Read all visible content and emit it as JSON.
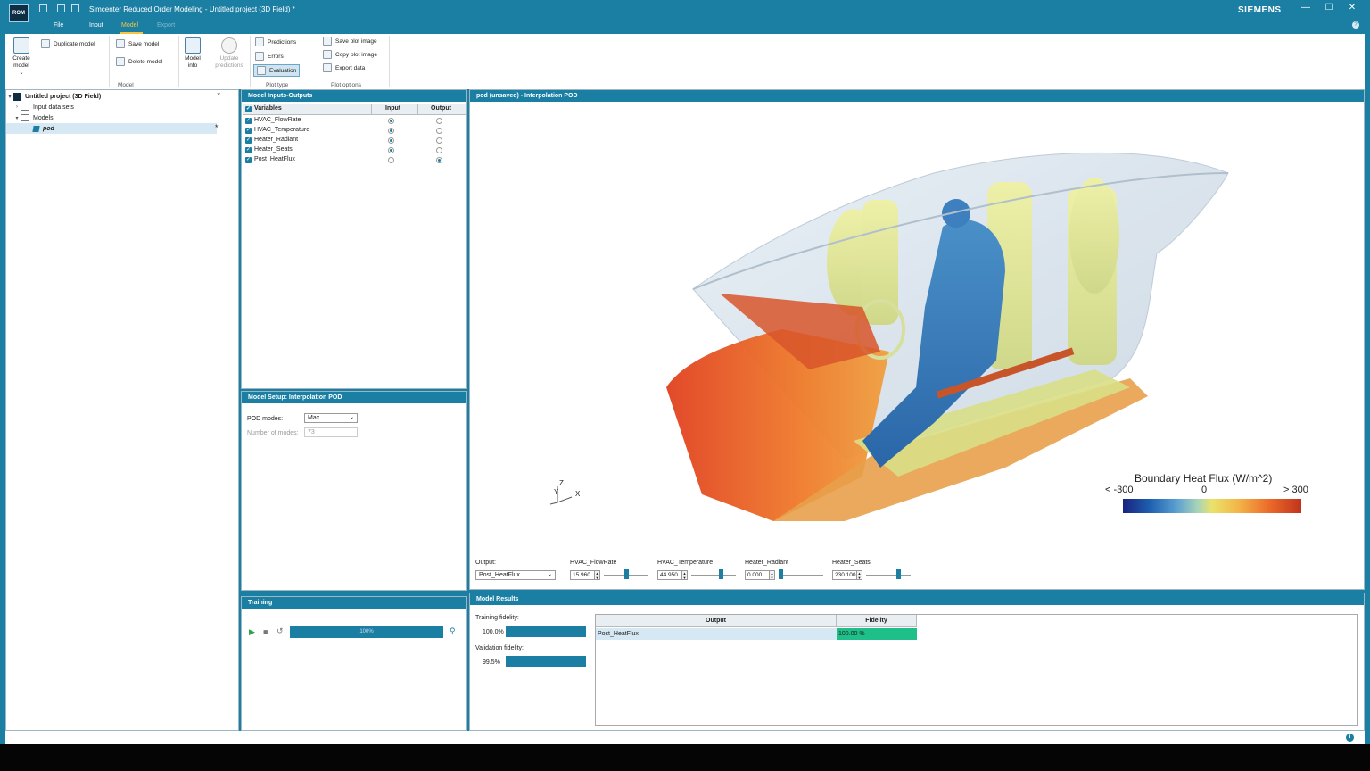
{
  "app": {
    "title": "Simcenter Reduced Order Modeling - Untitled project (3D Field) *",
    "brand": "SIEMENS",
    "logo_text": "ROM",
    "window_controls": [
      "—",
      "☐",
      "✕"
    ],
    "help": "?"
  },
  "menu": {
    "file": "File",
    "input": "Input",
    "model": "Model",
    "export": "Export",
    "active": "Model"
  },
  "ribbon": {
    "create_model": "Create model",
    "duplicate_model": "Duplicate model",
    "save_model": "Save model",
    "delete_model": "Delete model",
    "model_info": "Model info",
    "update_predictions": "Update predictions",
    "model_group": "Model",
    "predictions": "Predictions",
    "errors": "Errors",
    "evaluation": "Evaluation",
    "plot_type_group": "Plot type",
    "save_plot_image": "Save plot image",
    "copy_plot_image": "Copy plot image",
    "export_data": "Export data",
    "plot_options_group": "Plot options"
  },
  "tree": {
    "project": "Untitled project (3D Field)",
    "input_data_sets": "Input data sets",
    "models": "Models",
    "pod": "pod",
    "modified_marker": "*"
  },
  "io_panel": {
    "header": "Model Inputs-Outputs",
    "col_variables": "Variables",
    "col_input": "Input",
    "col_output": "Output",
    "rows": [
      {
        "name": "HVAC_FlowRate",
        "input": true
      },
      {
        "name": "HVAC_Temperature",
        "input": true
      },
      {
        "name": "Heater_Radiant",
        "input": true
      },
      {
        "name": "Heater_Seats",
        "input": true
      },
      {
        "name": "Post_HeatFlux",
        "input": false
      }
    ]
  },
  "setup_panel": {
    "header": "Model Setup: Interpolation POD",
    "pod_modes_label": "POD modes:",
    "pod_modes_value": "Max",
    "num_modes_label": "Number of modes:",
    "num_modes_value": "73"
  },
  "training": {
    "header": "Training",
    "progress": 1.0,
    "progress_text": "100%"
  },
  "viewport": {
    "header": "pod (unsaved) - Interpolation POD",
    "axis_z": "Z",
    "axis_y": "Y",
    "axis_x": "X",
    "legend_title": "Boundary Heat Flux (W/m^2)",
    "legend_min": "< -300",
    "legend_mid": "0",
    "legend_max": "> 300",
    "output_label": "Output:",
    "output_value": "Post_HeatFlux",
    "sliders": [
      {
        "label": "HVAC_FlowRate",
        "value": "15.960",
        "fraction": 0.5
      },
      {
        "label": "HVAC_Temperature",
        "value": "44.950",
        "fraction": 0.68
      },
      {
        "label": "Heater_Radiant",
        "value": "0.000",
        "fraction": 0.0
      },
      {
        "label": "Heater_Seats",
        "value": "230.100",
        "fraction": 0.75
      }
    ]
  },
  "results": {
    "header": "Model Results",
    "training_fidelity_label": "Training fidelity:",
    "training_fidelity_value": "100.0%",
    "validation_fidelity_label": "Validation fidelity:",
    "validation_fidelity_value": "99.5%",
    "col_output": "Output",
    "col_fidelity": "Fidelity",
    "row_output": "Post_HeatFlux",
    "row_fidelity": "100.00 %"
  },
  "status": {
    "info": "i"
  },
  "colors": {
    "accent": "#1b7fa3",
    "menu_active": "#f5c542",
    "fidelity_good": "#1fbf8a"
  }
}
